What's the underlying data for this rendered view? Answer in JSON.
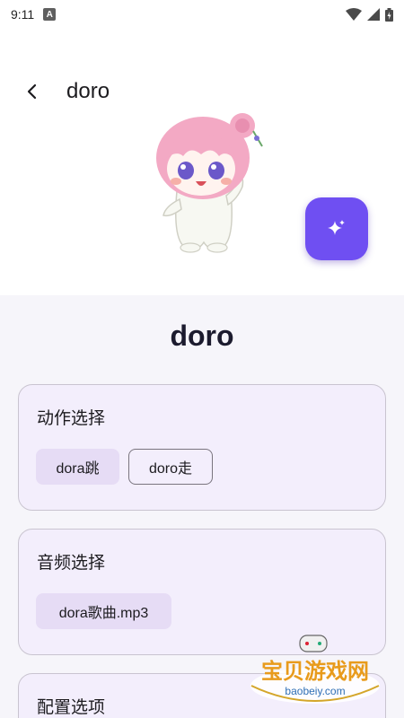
{
  "status_bar": {
    "time": "9:11",
    "notif_letter": "A"
  },
  "app_bar": {
    "title": "doro"
  },
  "character": {
    "name": "doro"
  },
  "cards": {
    "actions": {
      "title": "动作选择",
      "chips": [
        "dora跳",
        "doro走"
      ]
    },
    "audio": {
      "title": "音频选择",
      "chips": [
        "dora歌曲.mp3"
      ]
    },
    "config": {
      "title": "配置选项"
    }
  },
  "watermark": {
    "title": "宝贝游戏网",
    "url": "baobeiy.com"
  },
  "colors": {
    "accent": "#6f4ff2",
    "chip_selected": "#e6dcf5",
    "card_bg": "#f3eefc"
  }
}
